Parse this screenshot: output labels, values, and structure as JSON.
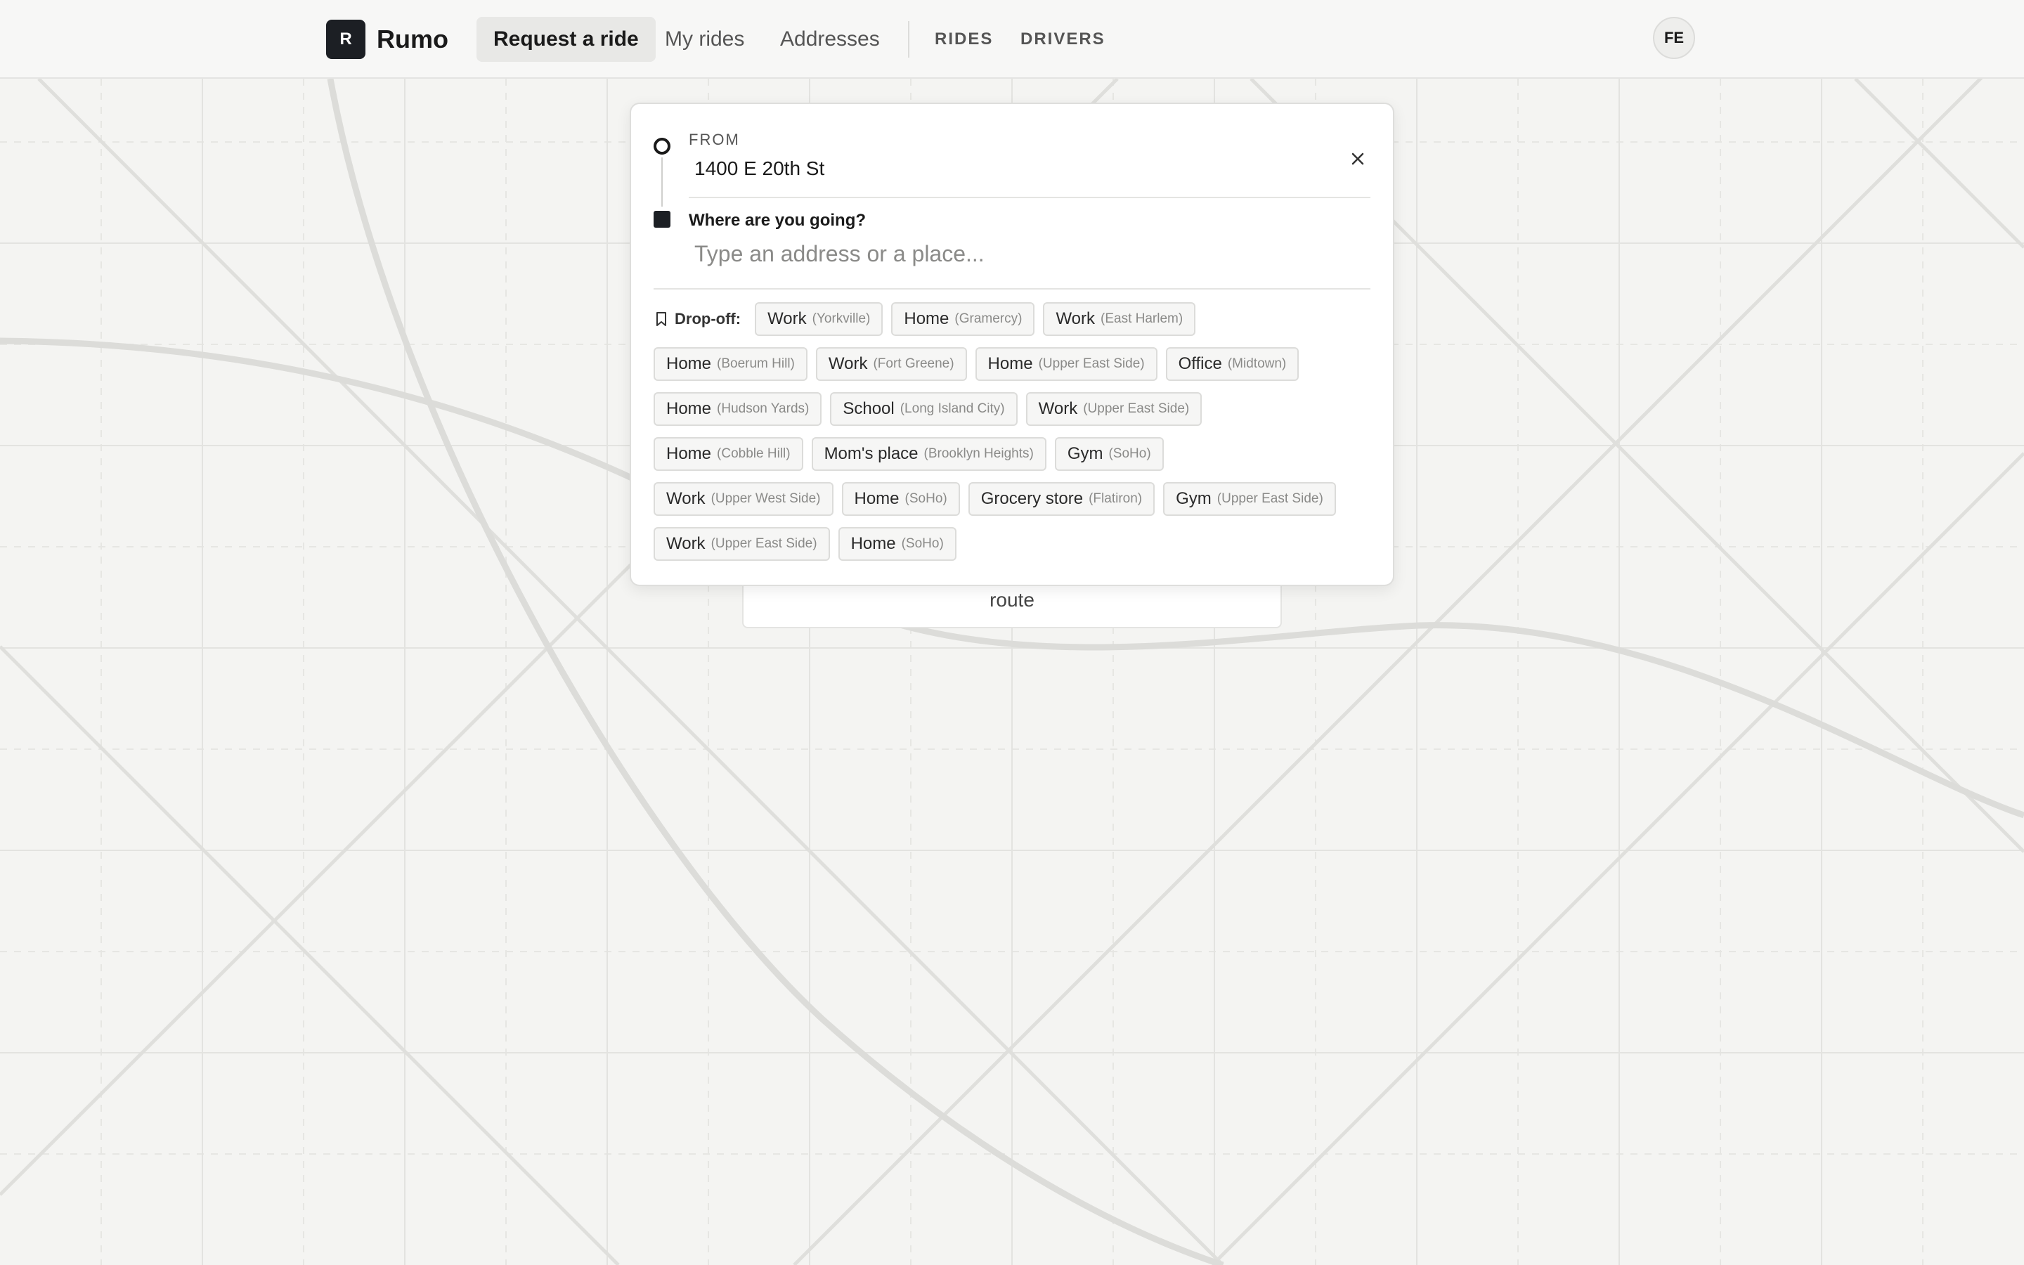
{
  "app": {
    "brand_letter": "R",
    "brand_name": "Rumo"
  },
  "nav": {
    "request": "Request a ride",
    "my_rides": "My rides",
    "addresses": "Addresses",
    "rides_caps": "RIDES",
    "drivers_caps": "DRIVERS"
  },
  "user": {
    "initials": "FE"
  },
  "route_card": {
    "text": "route"
  },
  "trip": {
    "from_label": "FROM",
    "from_value": "1400 E 20th St",
    "to_label": "Where are you going?",
    "to_placeholder": "Type an address or a place...",
    "to_value": ""
  },
  "dropoff": {
    "label": "Drop-off:",
    "rows": [
      [
        {
          "name": "Work",
          "area": "(Yorkville)"
        },
        {
          "name": "Home",
          "area": "(Gramercy)"
        },
        {
          "name": "Work",
          "area": "(East Harlem)"
        }
      ],
      [
        {
          "name": "Home",
          "area": "(Boerum Hill)"
        },
        {
          "name": "Work",
          "area": "(Fort Greene)"
        },
        {
          "name": "Home",
          "area": "(Upper East Side)"
        },
        {
          "name": "Office",
          "area": "(Midtown)"
        }
      ],
      [
        {
          "name": "Home",
          "area": "(Hudson Yards)"
        },
        {
          "name": "School",
          "area": "(Long Island City)"
        },
        {
          "name": "Work",
          "area": "(Upper East Side)"
        }
      ],
      [
        {
          "name": "Home",
          "area": "(Cobble Hill)"
        },
        {
          "name": "Mom's place",
          "area": "(Brooklyn Heights)"
        },
        {
          "name": "Gym",
          "area": "(SoHo)"
        }
      ],
      [
        {
          "name": "Work",
          "area": "(Upper West Side)"
        },
        {
          "name": "Home",
          "area": "(SoHo)"
        },
        {
          "name": "Grocery store",
          "area": "(Flatiron)"
        },
        {
          "name": "Gym",
          "area": "(Upper East Side)"
        }
      ],
      [
        {
          "name": "Work",
          "area": "(Upper East Side)"
        },
        {
          "name": "Home",
          "area": "(SoHo)"
        }
      ]
    ]
  },
  "icons": {
    "close": "close-icon",
    "bookmark": "bookmark-icon"
  },
  "colors": {
    "accent": "#1c1f24",
    "map_bg": "#f4f4f2",
    "map_road": "#dfdfdc"
  }
}
